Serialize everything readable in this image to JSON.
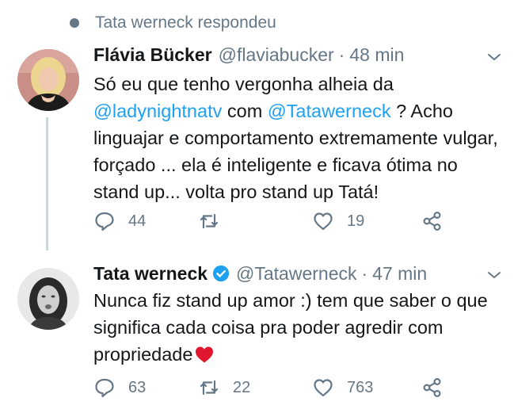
{
  "context": {
    "text": "Tata werneck respondeu"
  },
  "tweets": [
    {
      "name": "Flávia Bücker",
      "handle": "@flaviabucker",
      "separator": "·",
      "time": "48 min",
      "verified": false,
      "body": [
        {
          "t": "Só eu que tenho vergonha alheia da "
        },
        {
          "t": "@ladynightnatv",
          "mention": true
        },
        {
          "t": " com "
        },
        {
          "t": "@Tatawerneck",
          "mention": true
        },
        {
          "t": " ? Acho linguajar e comportamento extremamente vulgar, forçado ... ela é inteligente e ficava ótima no stand up... volta pro stand up Tatá!"
        }
      ],
      "replies": "44",
      "retweets": "",
      "likes": "19"
    },
    {
      "name": "Tata werneck",
      "handle": "@Tatawerneck",
      "separator": "·",
      "time": "47 min",
      "verified": true,
      "body": [
        {
          "t": "Nunca fiz stand up amor :) tem que saber o que significa cada coisa pra poder agredir com propriedade"
        }
      ],
      "replies": "63",
      "retweets": "22",
      "likes": "763"
    }
  ],
  "colors": {
    "accent": "#1da1f2",
    "muted": "#657786",
    "text": "#14171a",
    "thread_line": "#cdd6dd",
    "heart_emoji": "#e0182d"
  }
}
